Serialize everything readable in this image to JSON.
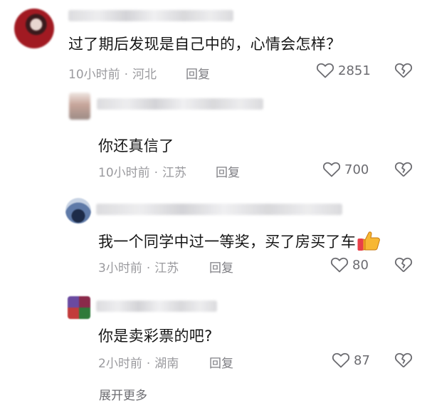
{
  "comments": [
    {
      "text": "过了期后发现是自己中的，心情会怎样？",
      "time": "10小时前",
      "location": "河北",
      "reply_label": "回复",
      "likes": "2851",
      "avatar_color": "#a11a22"
    },
    {
      "text": "你还真信了",
      "time": "10小时前",
      "location": "江苏",
      "reply_label": "回复",
      "likes": "700",
      "avatar_color": "#c7a59a"
    },
    {
      "text": "我一个同学中过一等奖，买了房买了车",
      "time": "3小时前",
      "location": "江苏",
      "reply_label": "回复",
      "likes": "80",
      "avatar_color": "#4a5f86",
      "emoji": "thumbs-up-icon"
    },
    {
      "text": "你是卖彩票的吧?",
      "time": "2小时前",
      "location": "湖南",
      "reply_label": "回复",
      "likes": "87",
      "avatar_color": "#8a2a4a"
    }
  ],
  "expand_more": "展开更多",
  "dot_separator": "·"
}
